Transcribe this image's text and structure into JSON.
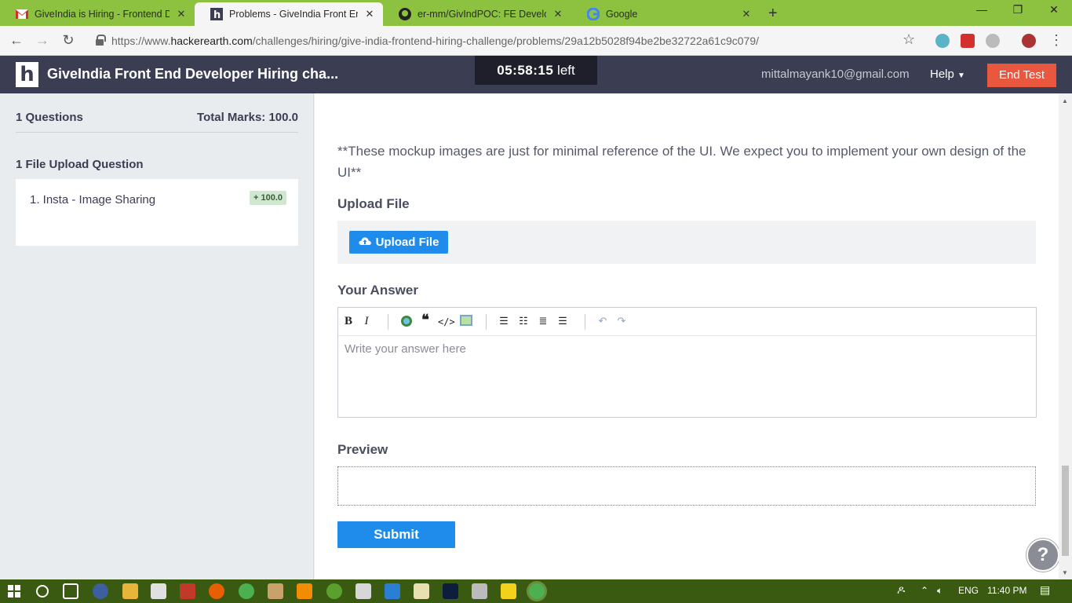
{
  "browser": {
    "tabs": [
      {
        "title": "GiveIndia is Hiring - Frontend De",
        "icon": "gmail-icon",
        "active": false
      },
      {
        "title": "Problems - GiveIndia Front End D",
        "icon": "hackerearth-icon",
        "active": true
      },
      {
        "title": "er-mm/GivIndPOC: FE Developer",
        "icon": "github-icon",
        "active": false
      },
      {
        "title": "Google",
        "icon": "google-icon",
        "active": false
      }
    ],
    "url_prefix": "https://www.",
    "url_host": "hackerearth.com",
    "url_path": "/challenges/hiring/give-india-frontend-hiring-challenge/problems/29a12b5028f94be2be32722a61c9c079/"
  },
  "header": {
    "logo_letter": "h",
    "title": "GiveIndia Front End Developer Hiring cha...",
    "timer_value": "05:58:15",
    "timer_suffix": "left",
    "email": "mittalmayank10@gmail.com",
    "help_label": "Help",
    "end_test_label": "End Test"
  },
  "sidebar": {
    "questions_count": "1 Questions",
    "total_marks": "Total Marks: 100.0",
    "section_title": "1 File Upload Question",
    "question_title": "1. Insta - Image Sharing",
    "question_marks": "+ 100.0"
  },
  "main": {
    "note": "**These mockup images are just for minimal reference of the UI. We expect you to implement your own design of the UI**",
    "upload_label": "Upload File",
    "upload_button": "Upload File",
    "answer_label": "Your Answer",
    "answer_placeholder": "Write your answer here",
    "preview_label": "Preview",
    "submit_label": "Submit",
    "help_fab": "?"
  },
  "taskbar": {
    "language": "ENG",
    "time": "11:40 PM"
  },
  "colors": {
    "tab_strip": "#8cc23f",
    "header_bg": "#3b3e52",
    "primary_button": "#1f8ceb",
    "end_test": "#e9573f"
  }
}
